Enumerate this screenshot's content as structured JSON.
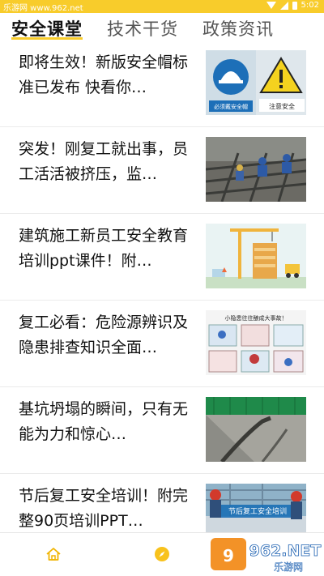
{
  "status_bar": {
    "source_label": "乐游网 www.962.net",
    "time": "5:02",
    "background_color": "#f8cc2b"
  },
  "tabs": [
    {
      "label": "安全课堂",
      "active": true
    },
    {
      "label": "技术干货",
      "active": false
    },
    {
      "label": "政策资讯",
      "active": false
    }
  ],
  "articles": [
    {
      "title": "即将生效！新版安全帽标准已发布 快看你…",
      "thumb_text_1": "必须戴安全帽",
      "thumb_text_2": "注意安全"
    },
    {
      "title": "突发！刚复工就出事，员工活活被挤压，监…"
    },
    {
      "title": "建筑施工新员工安全教育培训ppt课件！附…"
    },
    {
      "title": "复工必看：危险源辨识及隐患排查知识全面…",
      "thumb_text_1": "小隐患往往酿成大事故！"
    },
    {
      "title": "基坑坍塌的瞬间，只有无能为力和惊心…"
    },
    {
      "title": "节后复工安全培训！附完整90页培训PPT…",
      "thumb_text_1": "节后复工安全培训"
    }
  ],
  "bottom_nav": [
    {
      "icon": "home-icon"
    },
    {
      "icon": "compass-icon"
    }
  ],
  "watermark": {
    "brand": "962.NET",
    "sub": "乐游网"
  },
  "accent_color": "#f8cc2b"
}
